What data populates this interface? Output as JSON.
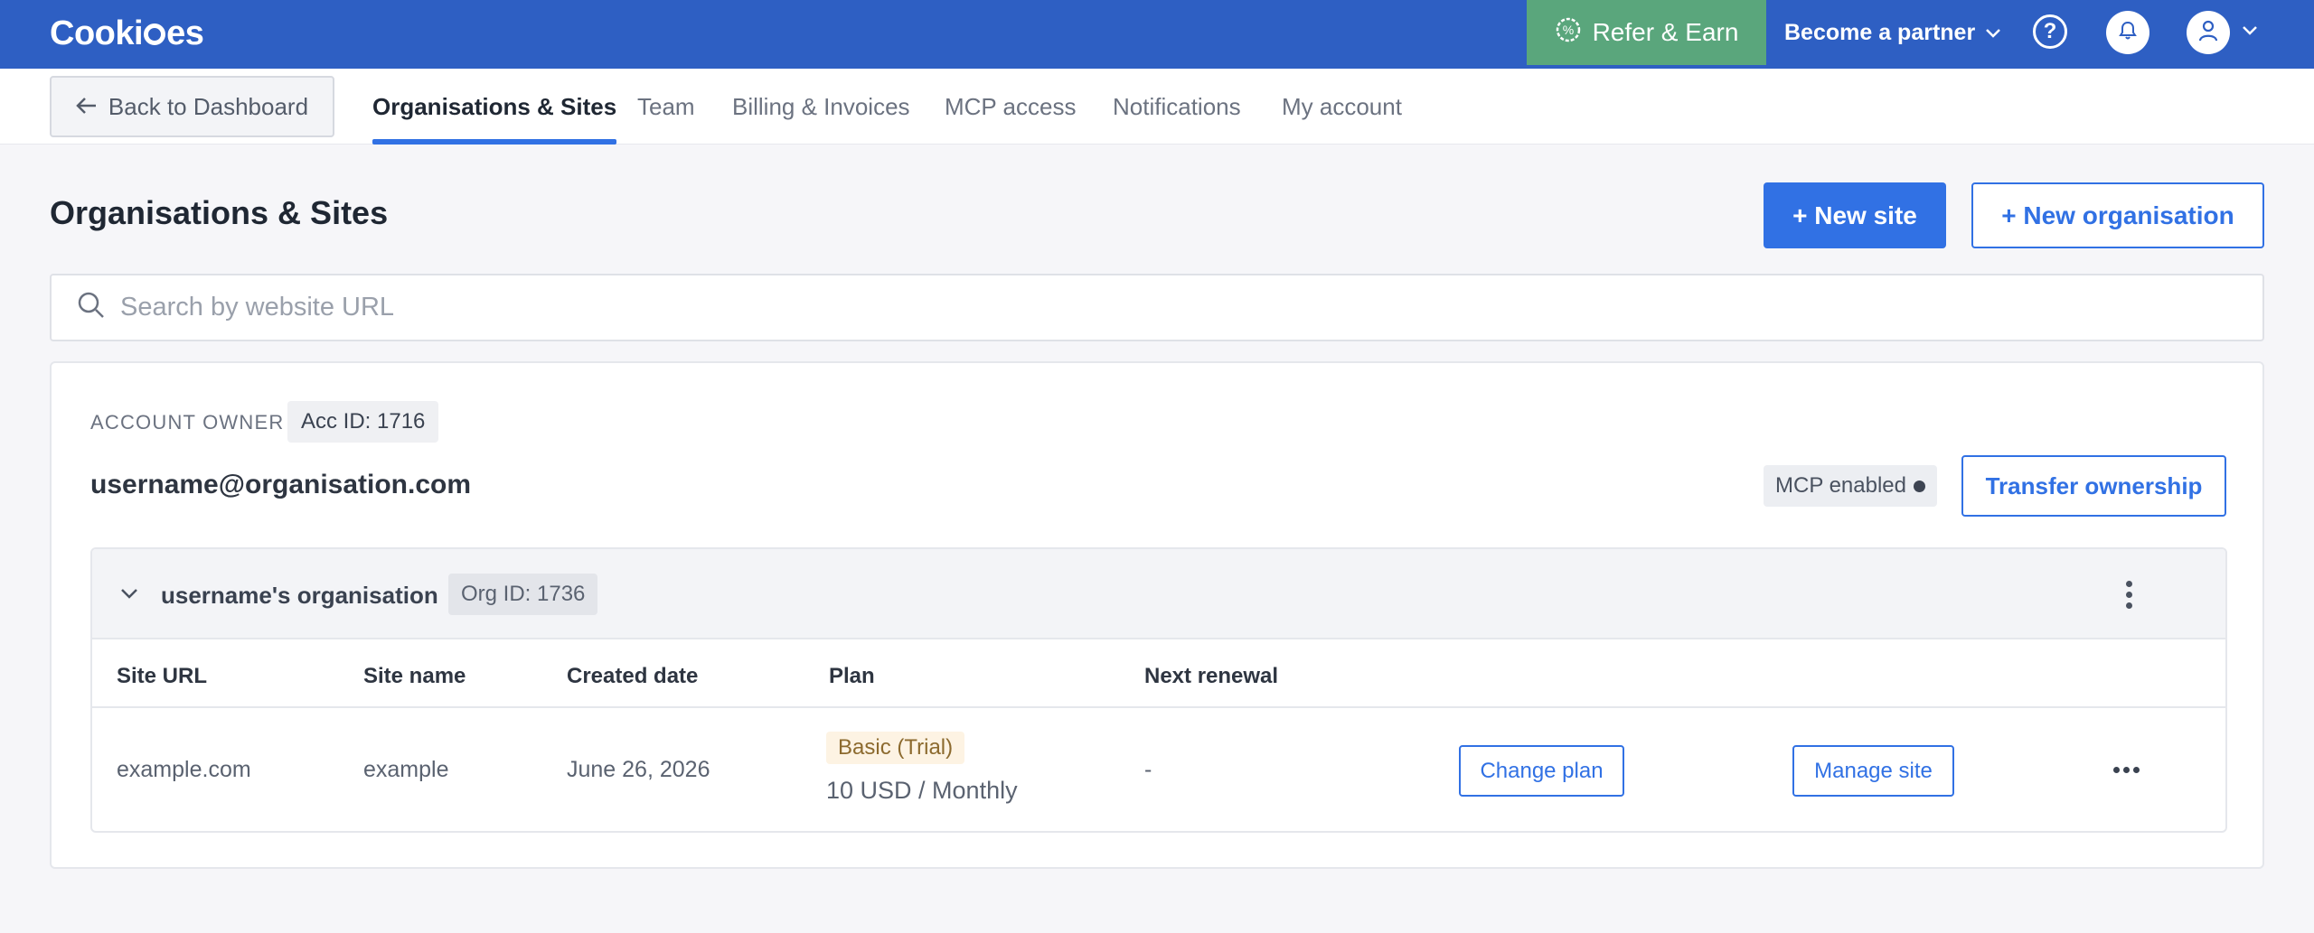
{
  "header": {
    "logo_text_1": "Cooki",
    "logo_text_2": "es",
    "refer_label": "Refer & Earn",
    "partner_label": "Become a partner"
  },
  "nav": {
    "back_label": "Back to Dashboard",
    "tabs": [
      {
        "label": "Organisations & Sites",
        "active": true
      },
      {
        "label": "Team",
        "active": false
      },
      {
        "label": "Billing & Invoices",
        "active": false
      },
      {
        "label": "MCP access",
        "active": false
      },
      {
        "label": "Notifications",
        "active": false
      },
      {
        "label": "My account",
        "active": false
      }
    ]
  },
  "page": {
    "title": "Organisations & Sites",
    "new_site_label": "+ New site",
    "new_org_label": "+ New organisation",
    "search_placeholder": "Search by website URL",
    "search_value": ""
  },
  "account": {
    "owner_label": "ACCOUNT OWNER",
    "acc_id": "Acc ID: 1716",
    "email": "username@organisation.com",
    "mcp_label": "MCP enabled",
    "transfer_label": "Transfer ownership"
  },
  "organisation": {
    "name": "username's organisation",
    "org_id": "Org ID: 1736",
    "columns": [
      "Site URL",
      "Site name",
      "Created date",
      "Plan",
      "Next renewal"
    ],
    "rows": [
      {
        "site_url": "example.com",
        "site_name": "example",
        "created": "June 26, 2026",
        "plan_badge": "Basic (Trial)",
        "plan_price": "10 USD / Monthly",
        "next_renewal": "-",
        "change_plan_label": "Change plan",
        "manage_label": "Manage site"
      }
    ]
  },
  "colors": {
    "brand": "#2e5fc3",
    "accent": "#3171e4",
    "refer": "#5aa67c",
    "trial_badge_bg": "#fdf3e3"
  },
  "icons": [
    "refer-icon",
    "chevron-down-icon",
    "help-icon",
    "bell-icon",
    "user-icon",
    "arrow-left-icon",
    "search-icon",
    "kebab-vertical-icon",
    "more-horizontal-icon"
  ]
}
